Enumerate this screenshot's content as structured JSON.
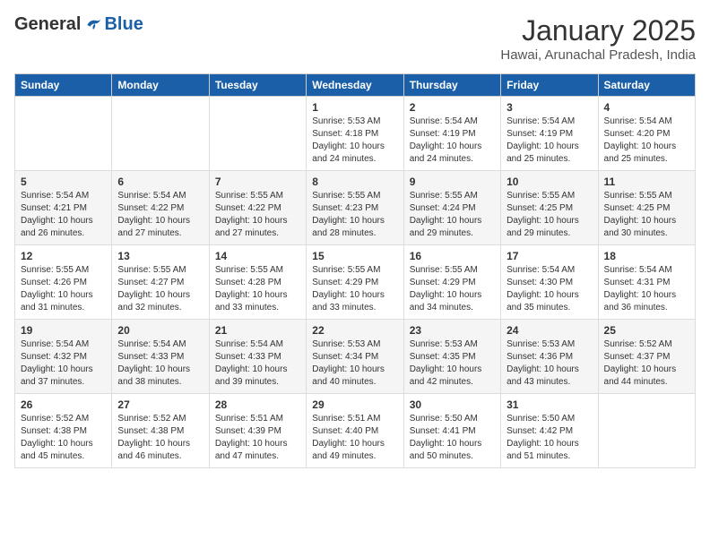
{
  "header": {
    "logo_general": "General",
    "logo_blue": "Blue",
    "month_title": "January 2025",
    "location": "Hawai, Arunachal Pradesh, India"
  },
  "weekdays": [
    "Sunday",
    "Monday",
    "Tuesday",
    "Wednesday",
    "Thursday",
    "Friday",
    "Saturday"
  ],
  "weeks": [
    [
      {
        "day": "",
        "info": ""
      },
      {
        "day": "",
        "info": ""
      },
      {
        "day": "",
        "info": ""
      },
      {
        "day": "1",
        "info": "Sunrise: 5:53 AM\nSunset: 4:18 PM\nDaylight: 10 hours\nand 24 minutes."
      },
      {
        "day": "2",
        "info": "Sunrise: 5:54 AM\nSunset: 4:19 PM\nDaylight: 10 hours\nand 24 minutes."
      },
      {
        "day": "3",
        "info": "Sunrise: 5:54 AM\nSunset: 4:19 PM\nDaylight: 10 hours\nand 25 minutes."
      },
      {
        "day": "4",
        "info": "Sunrise: 5:54 AM\nSunset: 4:20 PM\nDaylight: 10 hours\nand 25 minutes."
      }
    ],
    [
      {
        "day": "5",
        "info": "Sunrise: 5:54 AM\nSunset: 4:21 PM\nDaylight: 10 hours\nand 26 minutes."
      },
      {
        "day": "6",
        "info": "Sunrise: 5:54 AM\nSunset: 4:22 PM\nDaylight: 10 hours\nand 27 minutes."
      },
      {
        "day": "7",
        "info": "Sunrise: 5:55 AM\nSunset: 4:22 PM\nDaylight: 10 hours\nand 27 minutes."
      },
      {
        "day": "8",
        "info": "Sunrise: 5:55 AM\nSunset: 4:23 PM\nDaylight: 10 hours\nand 28 minutes."
      },
      {
        "day": "9",
        "info": "Sunrise: 5:55 AM\nSunset: 4:24 PM\nDaylight: 10 hours\nand 29 minutes."
      },
      {
        "day": "10",
        "info": "Sunrise: 5:55 AM\nSunset: 4:25 PM\nDaylight: 10 hours\nand 29 minutes."
      },
      {
        "day": "11",
        "info": "Sunrise: 5:55 AM\nSunset: 4:25 PM\nDaylight: 10 hours\nand 30 minutes."
      }
    ],
    [
      {
        "day": "12",
        "info": "Sunrise: 5:55 AM\nSunset: 4:26 PM\nDaylight: 10 hours\nand 31 minutes."
      },
      {
        "day": "13",
        "info": "Sunrise: 5:55 AM\nSunset: 4:27 PM\nDaylight: 10 hours\nand 32 minutes."
      },
      {
        "day": "14",
        "info": "Sunrise: 5:55 AM\nSunset: 4:28 PM\nDaylight: 10 hours\nand 33 minutes."
      },
      {
        "day": "15",
        "info": "Sunrise: 5:55 AM\nSunset: 4:29 PM\nDaylight: 10 hours\nand 33 minutes."
      },
      {
        "day": "16",
        "info": "Sunrise: 5:55 AM\nSunset: 4:29 PM\nDaylight: 10 hours\nand 34 minutes."
      },
      {
        "day": "17",
        "info": "Sunrise: 5:54 AM\nSunset: 4:30 PM\nDaylight: 10 hours\nand 35 minutes."
      },
      {
        "day": "18",
        "info": "Sunrise: 5:54 AM\nSunset: 4:31 PM\nDaylight: 10 hours\nand 36 minutes."
      }
    ],
    [
      {
        "day": "19",
        "info": "Sunrise: 5:54 AM\nSunset: 4:32 PM\nDaylight: 10 hours\nand 37 minutes."
      },
      {
        "day": "20",
        "info": "Sunrise: 5:54 AM\nSunset: 4:33 PM\nDaylight: 10 hours\nand 38 minutes."
      },
      {
        "day": "21",
        "info": "Sunrise: 5:54 AM\nSunset: 4:33 PM\nDaylight: 10 hours\nand 39 minutes."
      },
      {
        "day": "22",
        "info": "Sunrise: 5:53 AM\nSunset: 4:34 PM\nDaylight: 10 hours\nand 40 minutes."
      },
      {
        "day": "23",
        "info": "Sunrise: 5:53 AM\nSunset: 4:35 PM\nDaylight: 10 hours\nand 42 minutes."
      },
      {
        "day": "24",
        "info": "Sunrise: 5:53 AM\nSunset: 4:36 PM\nDaylight: 10 hours\nand 43 minutes."
      },
      {
        "day": "25",
        "info": "Sunrise: 5:52 AM\nSunset: 4:37 PM\nDaylight: 10 hours\nand 44 minutes."
      }
    ],
    [
      {
        "day": "26",
        "info": "Sunrise: 5:52 AM\nSunset: 4:38 PM\nDaylight: 10 hours\nand 45 minutes."
      },
      {
        "day": "27",
        "info": "Sunrise: 5:52 AM\nSunset: 4:38 PM\nDaylight: 10 hours\nand 46 minutes."
      },
      {
        "day": "28",
        "info": "Sunrise: 5:51 AM\nSunset: 4:39 PM\nDaylight: 10 hours\nand 47 minutes."
      },
      {
        "day": "29",
        "info": "Sunrise: 5:51 AM\nSunset: 4:40 PM\nDaylight: 10 hours\nand 49 minutes."
      },
      {
        "day": "30",
        "info": "Sunrise: 5:50 AM\nSunset: 4:41 PM\nDaylight: 10 hours\nand 50 minutes."
      },
      {
        "day": "31",
        "info": "Sunrise: 5:50 AM\nSunset: 4:42 PM\nDaylight: 10 hours\nand 51 minutes."
      },
      {
        "day": "",
        "info": ""
      }
    ]
  ]
}
